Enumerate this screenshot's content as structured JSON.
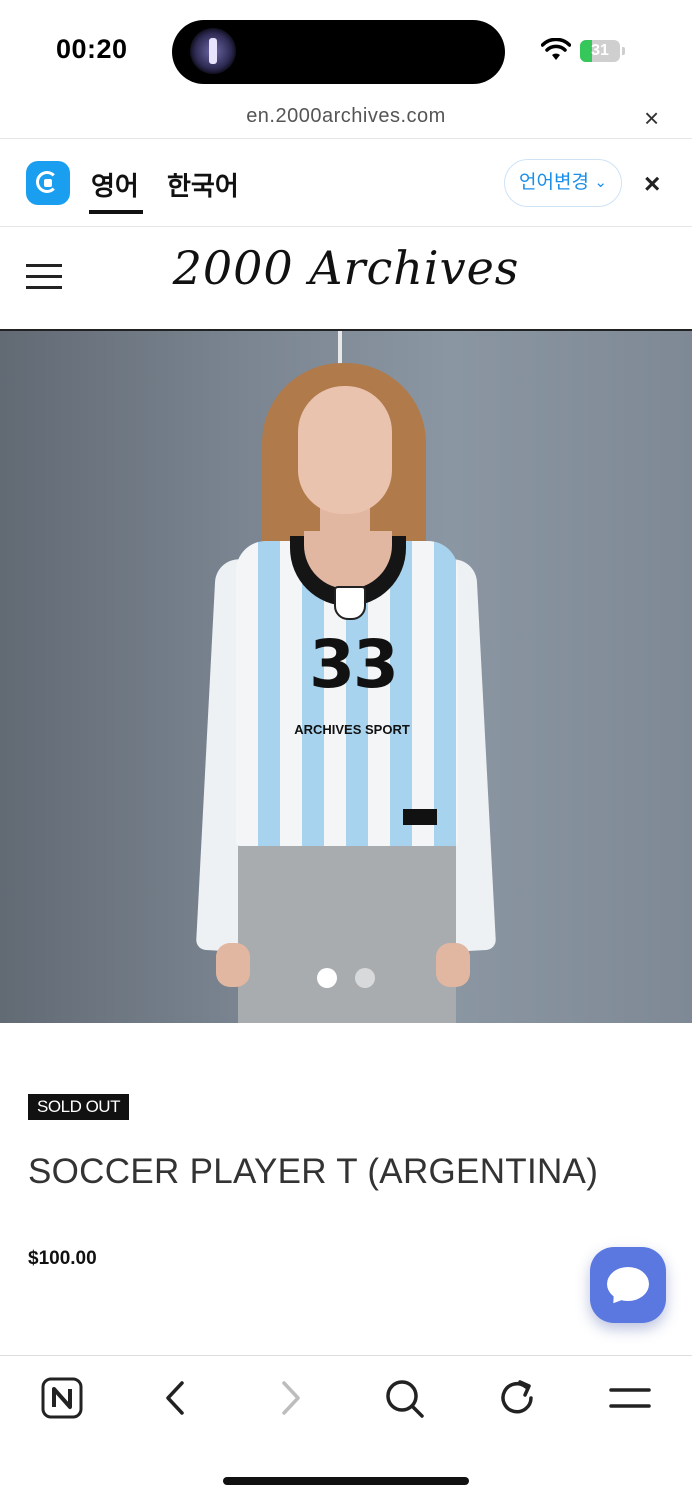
{
  "status_bar": {
    "time": "00:20",
    "battery": "31",
    "battery_level": 0.31
  },
  "browser": {
    "url": "en.2000archives.com",
    "close_label": "×"
  },
  "translation_bar": {
    "tabs": [
      "영어",
      "한국어"
    ],
    "active_tab": 0,
    "change_language_label": "언어변경",
    "close_label": "×"
  },
  "site": {
    "logo": "2000 Archives"
  },
  "product": {
    "jersey_number": "33",
    "jersey_text": "ARCHIVES SPORT",
    "badge": "SOLD OUT",
    "title": "SOCCER PLAYER T (ARGENTINA)",
    "price": "$100.00",
    "slide_count": 2,
    "active_slide": 0
  },
  "toolbar": {
    "items": [
      "naver-home-icon",
      "back-icon",
      "forward-icon",
      "search-icon",
      "reload-icon",
      "menu-icon"
    ]
  },
  "colors": {
    "accent": "#1a8ee8",
    "chat": "#5a78e0",
    "battery": "#35c759"
  }
}
